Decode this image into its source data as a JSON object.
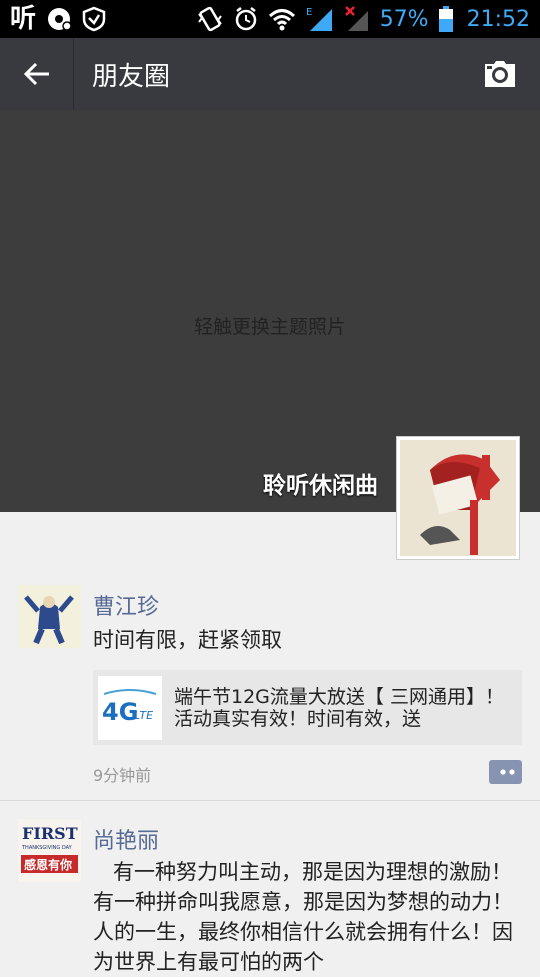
{
  "status_bar": {
    "app_glyph": "听",
    "battery_percent": "57%",
    "time": "21:52",
    "network_label": "E"
  },
  "header": {
    "title": "朋友圈"
  },
  "cover": {
    "hint": "轻触更换主题照片",
    "username": "聆听休闲曲"
  },
  "posts": [
    {
      "author": "曹江珍",
      "text": "时间有限，赶紧领取",
      "link_title": "端午节12G流量大放送【 三网通用】！活动真实有效！时间有效，送",
      "link_thumb_label": "4G",
      "link_thumb_sub": "LTE",
      "time": "9分钟前"
    },
    {
      "author": "尚艳丽",
      "avatar_label_top": "FIRST",
      "avatar_label_mid": "THANKSGIVING DAY",
      "avatar_label_bottom": "感恩有你",
      "text": "有一种努力叫主动，那是因为理想的激励！ 有一种拼命叫我愿意，那是因为梦想的动力！ 人的一生，最终你相信什么就会拥有什么！因为世界上有最可怕的两个"
    }
  ],
  "colors": {
    "header_bg": "#393a3f",
    "name_color": "#586b95",
    "accent_blue": "#3fa9f5"
  }
}
